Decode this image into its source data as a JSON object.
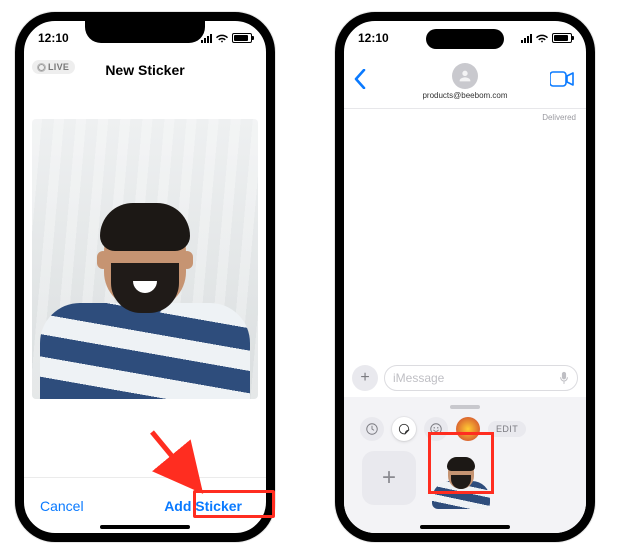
{
  "status": {
    "time": "12:10"
  },
  "left": {
    "live_label": "LIVE",
    "title": "New Sticker",
    "cancel_label": "Cancel",
    "add_label": "Add Sticker"
  },
  "right": {
    "contact_name": "products@beebom.com",
    "delivered_label": "Delivered",
    "compose_placeholder": "iMessage",
    "edit_label": "EDIT"
  },
  "colors": {
    "ios_blue": "#0a7aff",
    "annotation_red": "#ff2d20"
  }
}
